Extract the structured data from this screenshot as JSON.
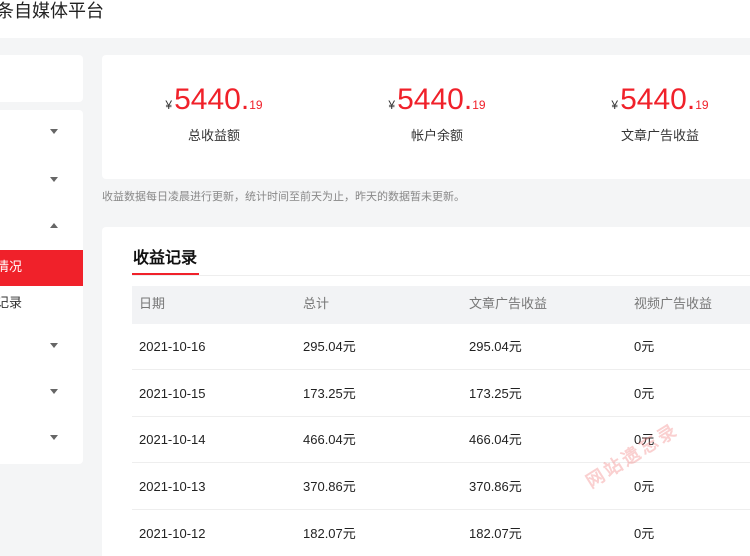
{
  "app": {
    "title": "条自媒体平台"
  },
  "sidebar": {
    "items": [
      {
        "label": "",
        "caret": "down"
      },
      {
        "label": "",
        "caret": "down"
      },
      {
        "label": "",
        "caret": "up"
      },
      {
        "label": "情况",
        "active": true
      },
      {
        "label": "记录"
      },
      {
        "label": "",
        "caret": "down"
      },
      {
        "label": "",
        "caret": "down"
      },
      {
        "label": "",
        "caret": "down"
      }
    ]
  },
  "summary": {
    "stats": [
      {
        "currency": "¥",
        "integer": "5440",
        "decimal": "19",
        "label": "总收益额"
      },
      {
        "currency": "¥",
        "integer": "5440",
        "decimal": "19",
        "label": "帐户余额"
      },
      {
        "currency": "¥",
        "integer": "5440",
        "decimal": "19",
        "label": "文章广告收益"
      }
    ],
    "note": "收益数据每日凌晨进行更新，统计时间至前天为止，昨天的数据暂未更新。"
  },
  "records": {
    "title": "收益记录",
    "columns": [
      "日期",
      "总计",
      "文章广告收益",
      "视频广告收益"
    ],
    "rows": [
      [
        "2021-10-16",
        "295.04元",
        "295.04元",
        "0元"
      ],
      [
        "2021-10-15",
        "173.25元",
        "173.25元",
        "0元"
      ],
      [
        "2021-10-14",
        "466.04元",
        "466.04元",
        "0元"
      ],
      [
        "2021-10-13",
        "370.86元",
        "370.86元",
        "0元"
      ],
      [
        "2021-10-12",
        "182.07元",
        "182.07元",
        "0元"
      ]
    ]
  },
  "watermark": {
    "text": "网站遗忘录"
  },
  "colors": {
    "accent": "#f0212a",
    "background": "#f4f5f6"
  }
}
